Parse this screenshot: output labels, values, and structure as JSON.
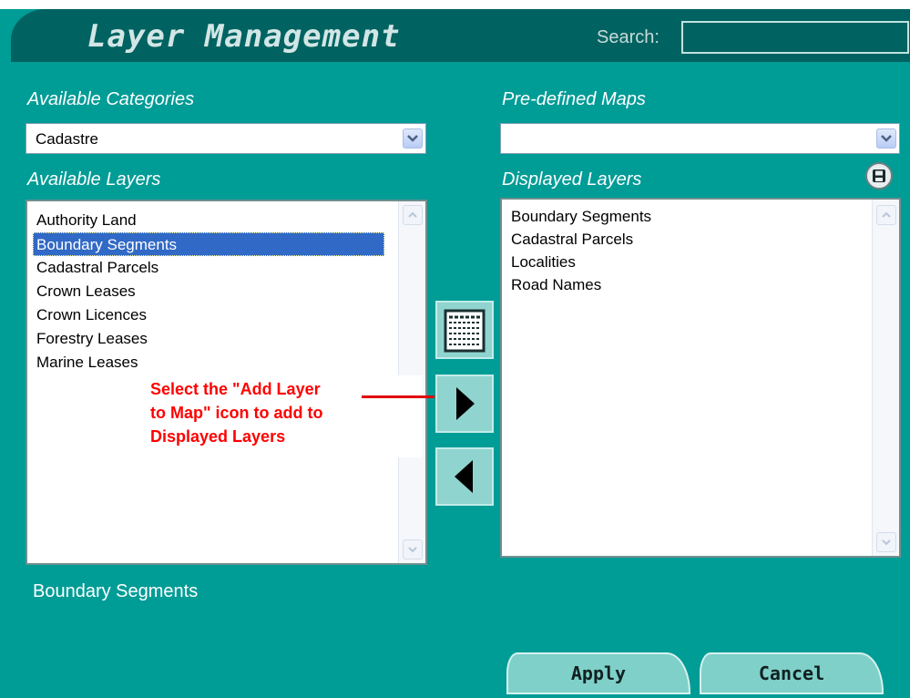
{
  "header": {
    "title": "Layer Management",
    "search_label": "Search:",
    "search_value": ""
  },
  "categories": {
    "label": "Available Categories",
    "selected": "Cadastre"
  },
  "predefined_maps": {
    "label": "Pre-defined Maps",
    "selected": ""
  },
  "available_layers": {
    "label": "Available Layers",
    "items": [
      "Authority Land",
      "Boundary Segments",
      "Cadastral Parcels",
      "Crown Leases",
      "Crown Licences",
      "Forestry Leases",
      "Marine Leases"
    ],
    "selected_index": 1
  },
  "displayed_layers": {
    "label": "Displayed Layers",
    "items": [
      "Boundary Segments",
      "Cadastral Parcels",
      "Localities",
      "Road Names"
    ]
  },
  "annotation": {
    "line1": "Select the \"Add Layer",
    "line2": "to Map\" icon to add to",
    "line3": "Displayed Layers"
  },
  "status": {
    "text": "Boundary Segments"
  },
  "buttons": {
    "apply": "Apply",
    "cancel": "Cancel"
  },
  "colors": {
    "panel_bg": "#009c96",
    "header_bg": "#006361",
    "selection": "#3169c6",
    "annotation": "#ff0000"
  },
  "icons": {
    "layer_details": "layer-list-icon",
    "add_layer": "arrow-right-icon",
    "remove_layer": "arrow-left-icon",
    "save_map": "save-icon"
  }
}
